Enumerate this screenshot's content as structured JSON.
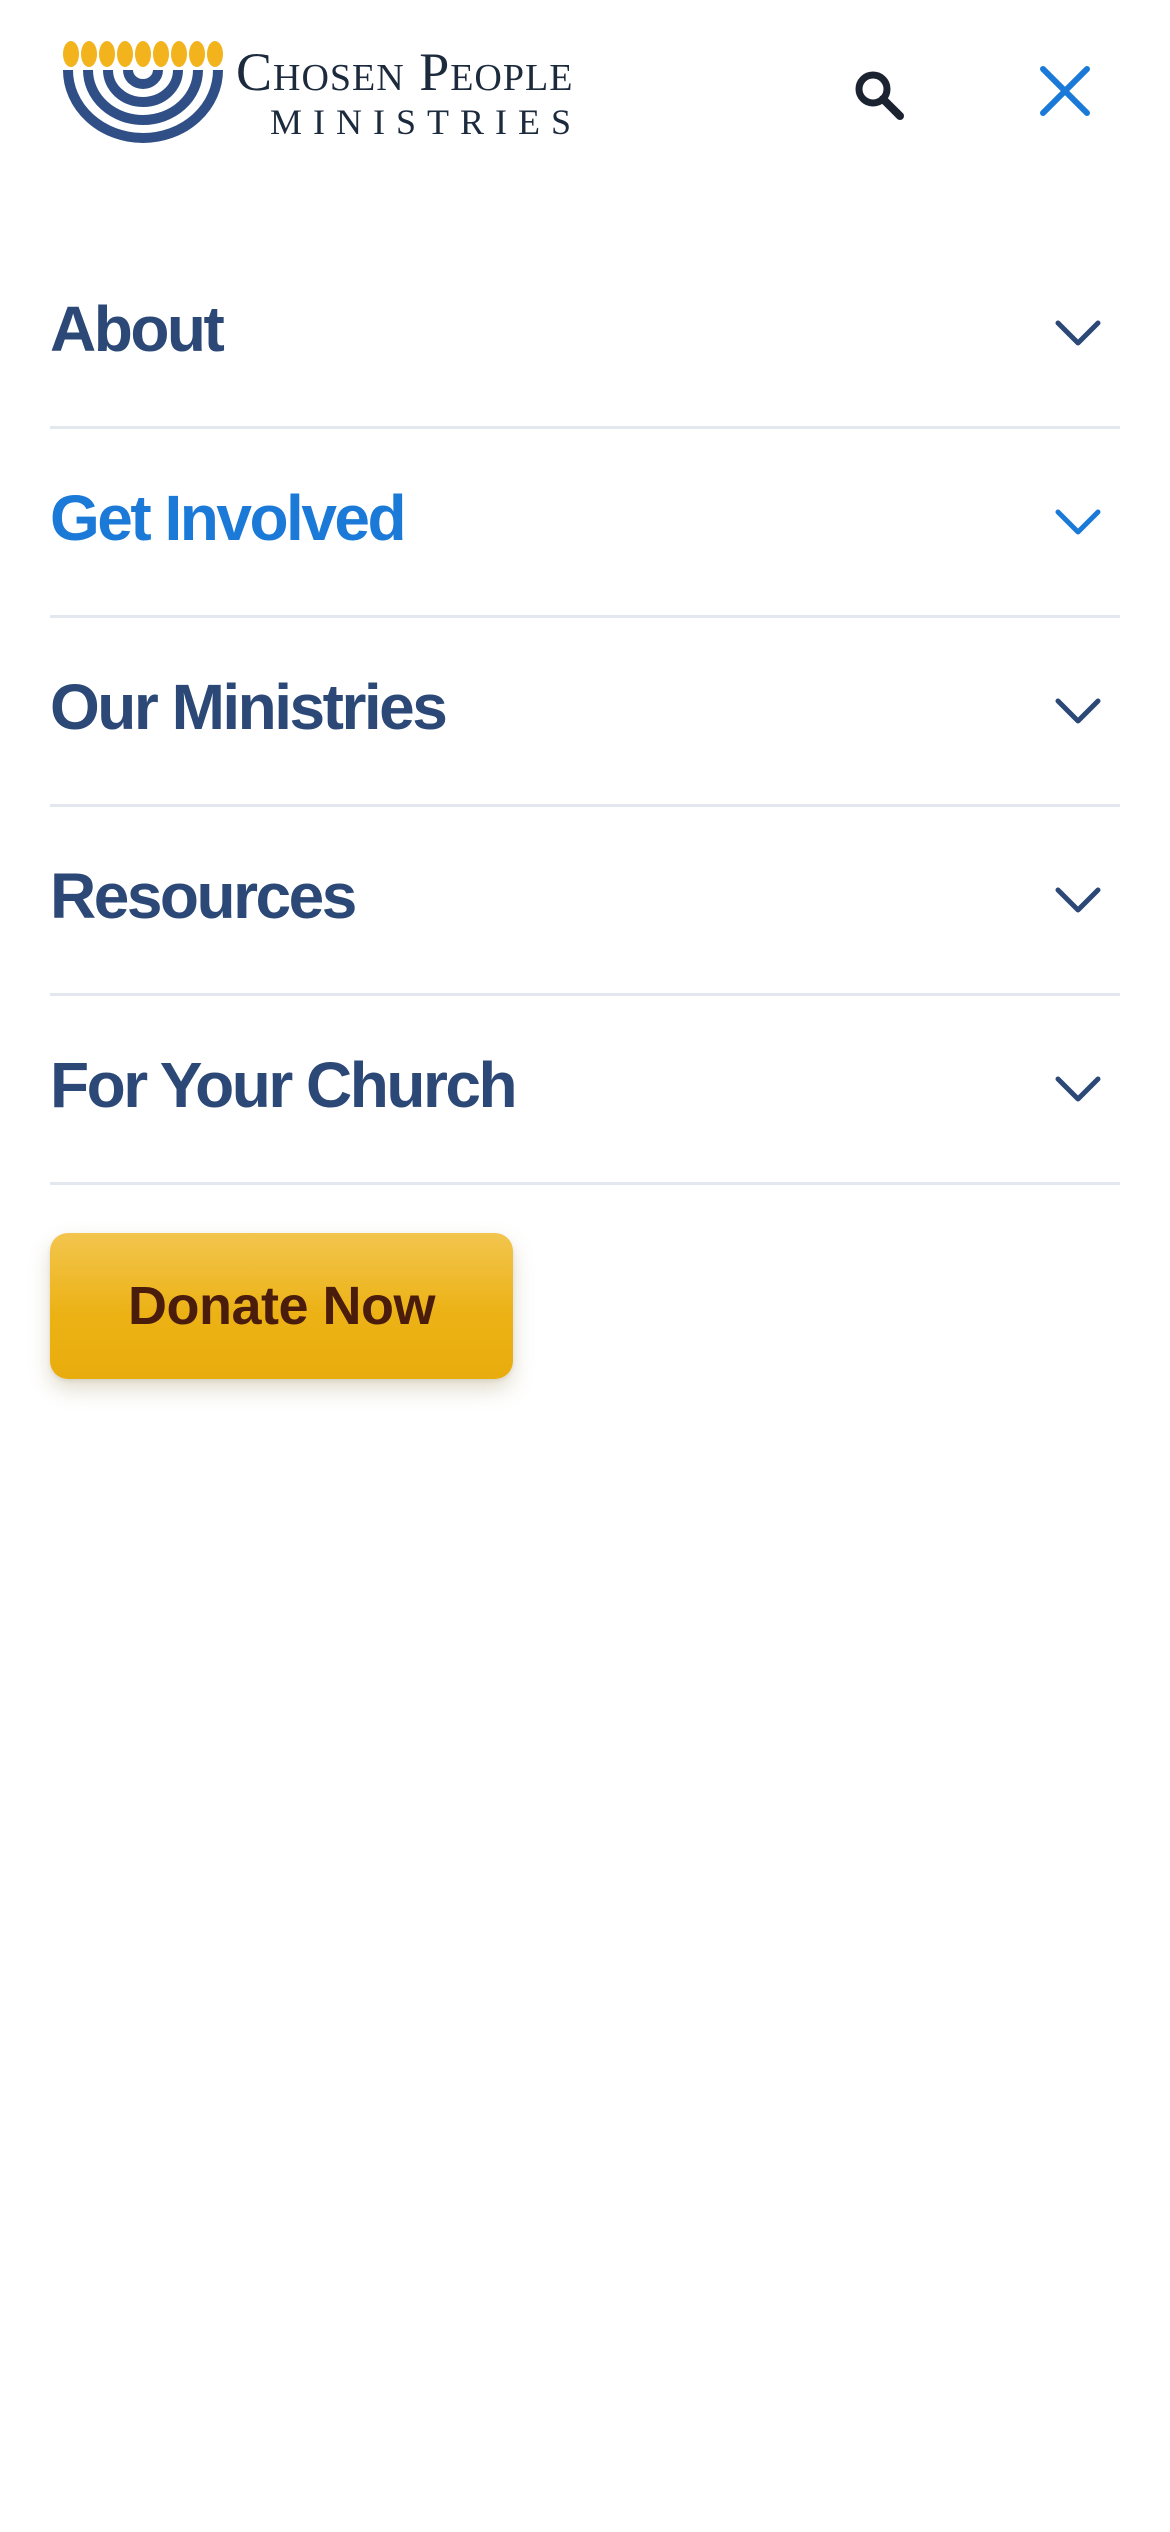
{
  "header": {
    "logo": {
      "name_line1": "Chosen People",
      "name_line2": "MINISTRIES",
      "mark_icon": "menorah-logo-icon",
      "colors": {
        "gold": "#f2b31c",
        "navy": "#2f4f86"
      }
    },
    "search_icon": "search-icon",
    "close_icon": "close-icon"
  },
  "menu": {
    "items": [
      {
        "label": "About",
        "active": false,
        "icon": "chevron-down-icon"
      },
      {
        "label": "Get Involved",
        "active": true,
        "icon": "chevron-down-icon"
      },
      {
        "label": "Our Ministries",
        "active": false,
        "icon": "chevron-down-icon"
      },
      {
        "label": "Resources",
        "active": false,
        "icon": "chevron-down-icon"
      },
      {
        "label": "For Your Church",
        "active": false,
        "icon": "chevron-down-icon"
      }
    ]
  },
  "donate": {
    "label": "Donate Now"
  },
  "colors": {
    "primary_text": "#2b4876",
    "active_text": "#1b7ad8",
    "divider": "#e3e8ee",
    "donate_bg": "#ecb215",
    "donate_text": "#4a1c0c",
    "close_icon": "#1b7ad8",
    "search_icon": "#1c2330"
  }
}
